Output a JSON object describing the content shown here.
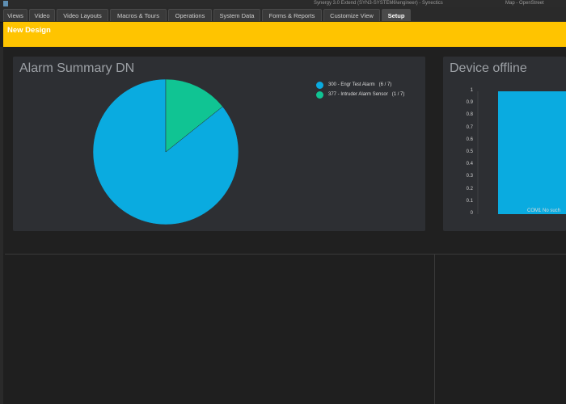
{
  "titlebar": {
    "app_title": "Synergy 3.0 Extend (SYN3-SYSTEM6\\engineer) - Synectics",
    "secondary_title": "Map - OpenStreet"
  },
  "menu": {
    "tabs": [
      {
        "label": "Views"
      },
      {
        "label": "Video"
      },
      {
        "label": "Video Layouts"
      },
      {
        "label": "Macros & Tours"
      },
      {
        "label": "Operations"
      },
      {
        "label": "System Data"
      },
      {
        "label": "Forms & Reports"
      },
      {
        "label": "Customize View"
      },
      {
        "label": "Setup",
        "active": true
      }
    ]
  },
  "banner": {
    "title": "New Design",
    "color": "#ffc400"
  },
  "panels": {
    "alarm_summary": {
      "title": "Alarm Summary DN",
      "legend": [
        {
          "label": "300 - Engr Test Alarm",
          "count": "(6 / 7)",
          "color": "#0aabe0"
        },
        {
          "label": "377 - Intruder Alarm Sensor",
          "count": "(1 / 7)",
          "color": "#10c493"
        }
      ]
    },
    "device_offline": {
      "title": "Device offline",
      "category_label": "COM1 No such"
    }
  },
  "chart_data": [
    {
      "type": "pie",
      "title": "Alarm Summary DN",
      "labels": [
        "300 - Engr Test Alarm",
        "377 - Intruder Alarm Sensor"
      ],
      "values": [
        6,
        1
      ],
      "colors": [
        "#0aabe0",
        "#10c493"
      ]
    },
    {
      "type": "bar",
      "title": "Device offline",
      "categories": [
        "COM1 No such"
      ],
      "values": [
        1
      ],
      "ylim": [
        0,
        1
      ],
      "yticks": [
        "1",
        "0.9",
        "0.8",
        "0.7",
        "0.6",
        "0.5",
        "0.4",
        "0.3",
        "0.2",
        "0.1",
        "0"
      ],
      "colors": [
        "#0aabe0"
      ]
    }
  ]
}
